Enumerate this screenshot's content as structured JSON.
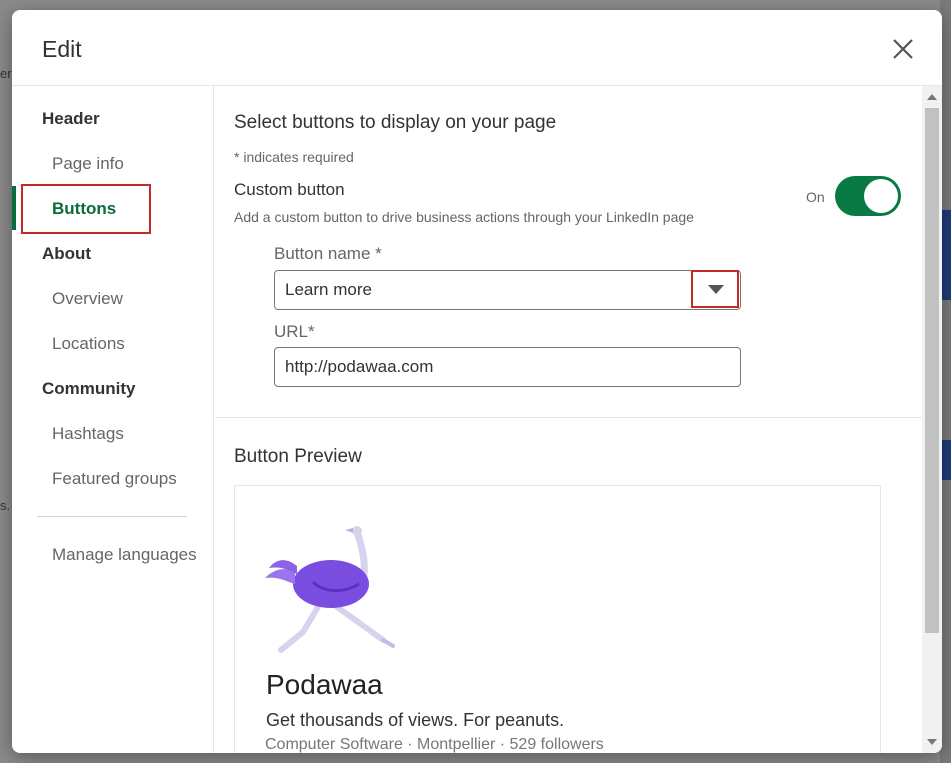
{
  "modal": {
    "title": "Edit",
    "close_icon": "close-icon"
  },
  "sidebar": {
    "sections": [
      {
        "label": "Header",
        "items": [
          {
            "label": "Page info"
          },
          {
            "label": "Buttons",
            "active": true
          }
        ]
      },
      {
        "label": "About",
        "items": [
          {
            "label": "Overview"
          },
          {
            "label": "Locations"
          }
        ]
      },
      {
        "label": "Community",
        "items": [
          {
            "label": "Hashtags"
          },
          {
            "label": "Featured groups"
          }
        ]
      }
    ],
    "footer_item": "Manage languages"
  },
  "main": {
    "heading": "Select buttons to display on your page",
    "required_note": "* indicates required",
    "custom_button": {
      "label": "Custom button",
      "description": "Add a custom button to drive business actions through your LinkedIn page",
      "toggle_label": "On",
      "toggle_on": true
    },
    "button_name": {
      "label": "Button name *",
      "value": "Learn more",
      "icon": "chevron-down-icon"
    },
    "url": {
      "label": "URL*",
      "value": "http://podawaa.com"
    }
  },
  "preview": {
    "heading": "Button Preview",
    "company_name": "Podawaa",
    "tagline": "Get thousands of views. For peanuts.",
    "meta": "Computer Software · Montpellier · 529 followers",
    "logo": "ostrich-logo"
  },
  "background": {
    "left_text_1": "er",
    "left_text_2": "s."
  },
  "colors": {
    "accent_green": "#0a6b3c",
    "highlight_red": "#c52a2a",
    "logo_purple": "#7a4de0"
  }
}
